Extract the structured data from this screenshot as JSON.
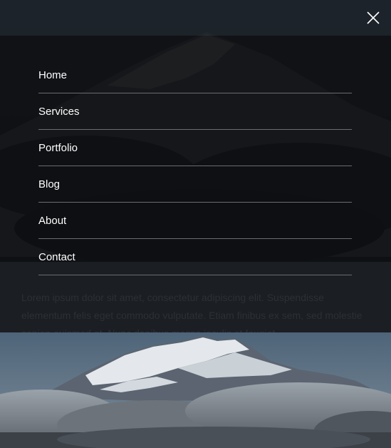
{
  "nav": {
    "close_icon": "close-icon",
    "items": [
      {
        "label": "Home"
      },
      {
        "label": "Services"
      },
      {
        "label": "Portfolio"
      },
      {
        "label": "Blog"
      },
      {
        "label": "About"
      },
      {
        "label": "Contact"
      }
    ]
  },
  "content": {
    "paragraph": "Lorem ipsum dolor sit amet, consectetur adipiscing elit. Suspendisse elementum felis eget commodo vulputate. Etiam finibus ex sem, sed molestie sapien euismod at. Nunc dapibus massa iaculis et feugiat"
  },
  "image": {
    "subject": "snow-capped mountain above clouds"
  }
}
